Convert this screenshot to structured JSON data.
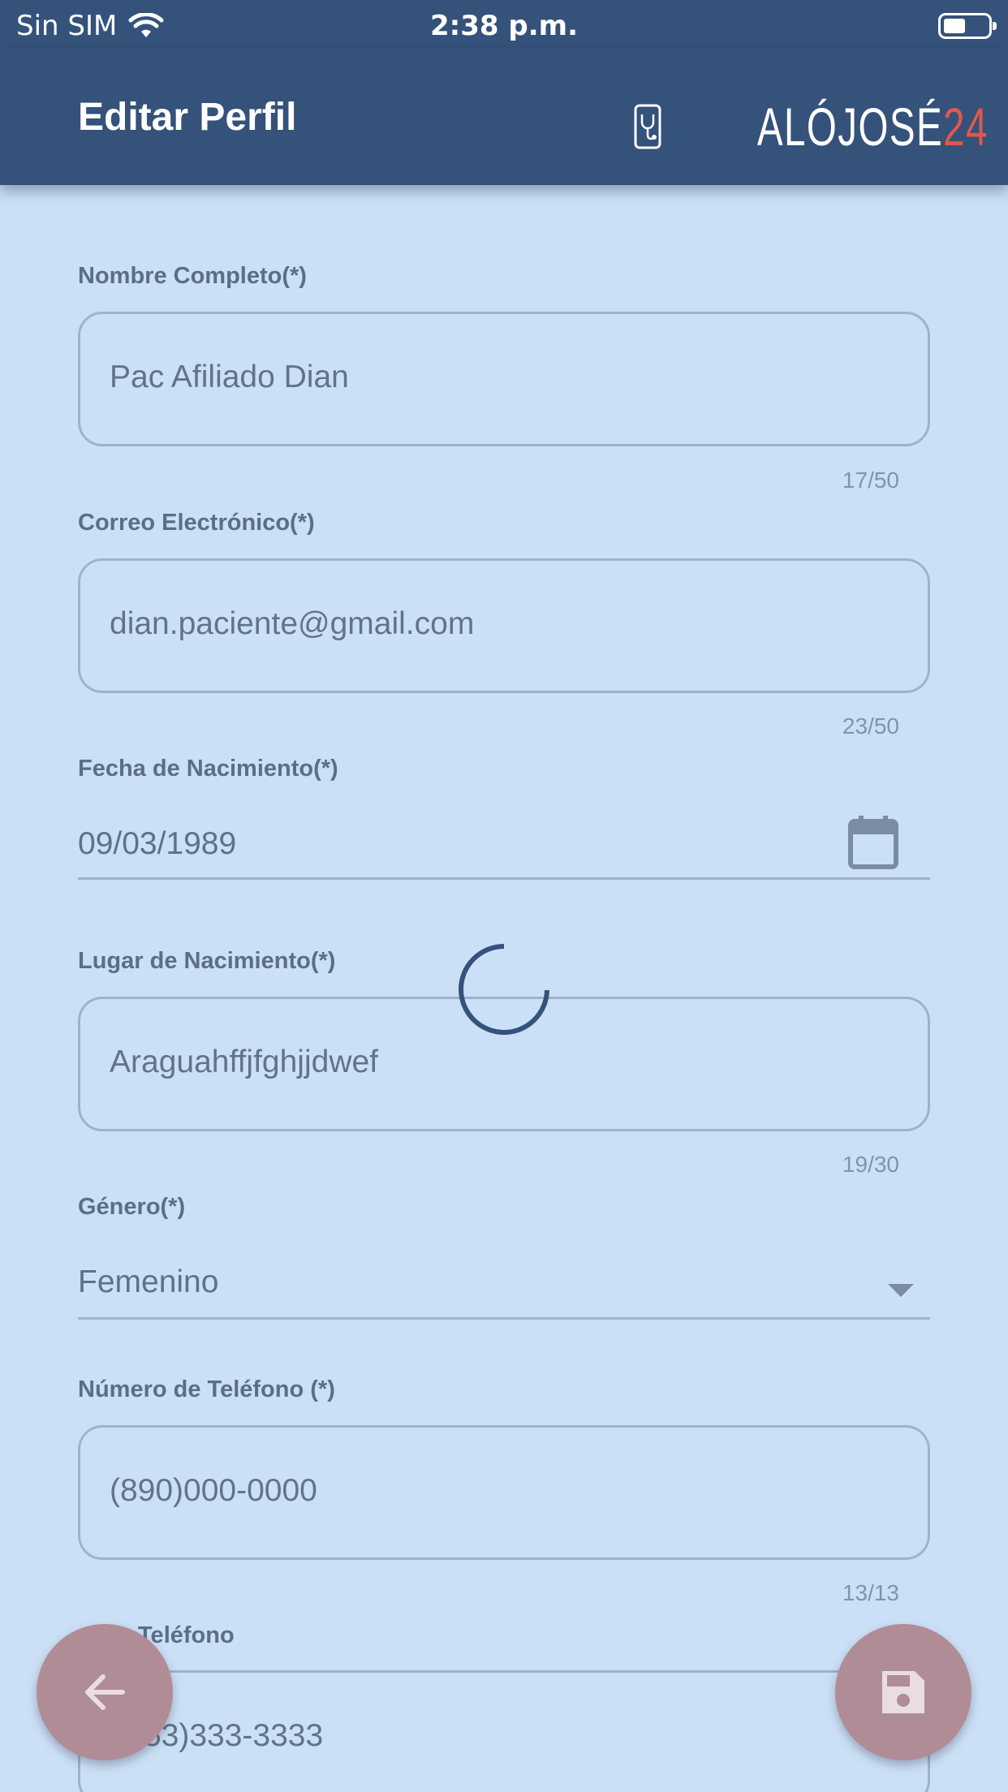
{
  "status_bar": {
    "carrier": "Sin SIM",
    "time": "2:38 p.m.",
    "icons": [
      "wifi-icon",
      "battery-icon"
    ]
  },
  "app_bar": {
    "title": "Editar Perfil",
    "logo_text": "ALÓJOSÉ",
    "logo_accent": "24",
    "logo_icon": "phone-stethoscope-icon"
  },
  "colors": {
    "app_bar": "#34527a",
    "background": "#cbe0f6",
    "fab": "#b08c97",
    "logo_accent": "#e2574c",
    "spinner": "#34527a"
  },
  "form": {
    "full_name": {
      "label": "Nombre Completo(*)",
      "value": "Pac Afiliado Dian",
      "counter": "17/50"
    },
    "email": {
      "label": "Correo Electrónico(*)",
      "value": "dian.paciente@gmail.com",
      "counter": "23/50"
    },
    "birth_date": {
      "label": "Fecha de Nacimiento(*)",
      "value": "09/03/1989",
      "icon": "calendar-icon"
    },
    "birth_place": {
      "label": "Lugar de Nacimiento(*)",
      "value": "Araguahffjfghjjdwef",
      "counter": "19/30"
    },
    "gender": {
      "label": "Género(*)",
      "value": "Femenino",
      "icon": "dropdown-arrow-icon"
    },
    "phone": {
      "label": "Número de Teléfono (*)",
      "value": "(890)000-0000",
      "counter": "13/13"
    },
    "other_phone": {
      "label": "Teléfono",
      "value": "53)333-3333"
    }
  },
  "fabs": {
    "back_icon": "arrow-left-icon",
    "save_icon": "floppy-disk-icon"
  },
  "loading_indicator": "spinner-icon"
}
